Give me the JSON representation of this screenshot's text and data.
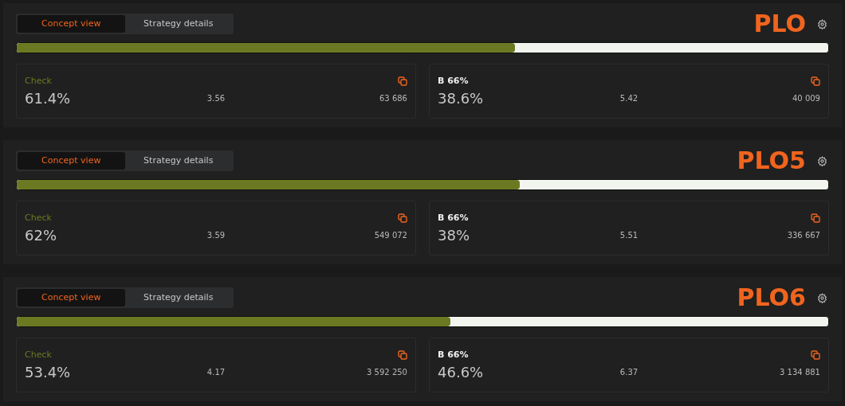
{
  "panels": [
    {
      "tabs": [
        {
          "label": "Concept view",
          "selected": true
        },
        {
          "label": "Strategy details",
          "selected": false
        }
      ],
      "title": "PLO",
      "bar": {
        "level": 0.614
      },
      "cards": [
        {
          "kind": "check",
          "label": "Check",
          "percent": "61.4%",
          "value": "3.56",
          "count": "63 686"
        },
        {
          "kind": "bet",
          "label": "B 66%",
          "percent": "38.6%",
          "value": "5.42",
          "count": "40 009"
        }
      ]
    },
    {
      "tabs": [
        {
          "label": "Concept view",
          "selected": true
        },
        {
          "label": "Strategy details",
          "selected": false
        }
      ],
      "title": "PLO5",
      "bar": {
        "level": 0.62
      },
      "cards": [
        {
          "kind": "check",
          "label": "Check",
          "percent": "62%",
          "value": "3.59",
          "count": "549 072"
        },
        {
          "kind": "bet",
          "label": "B 66%",
          "percent": "38%",
          "value": "5.51",
          "count": "336 667"
        }
      ]
    },
    {
      "tabs": [
        {
          "label": "Concept view",
          "selected": true
        },
        {
          "label": "Strategy details",
          "selected": false
        }
      ],
      "title": "PLO6",
      "bar": {
        "level": 0.534
      },
      "cards": [
        {
          "kind": "check",
          "label": "Check",
          "percent": "53.4%",
          "value": "4.17",
          "count": "3 592 250"
        },
        {
          "kind": "bet",
          "label": "B 66%",
          "percent": "46.6%",
          "value": "6.37",
          "count": "3 134 881"
        }
      ]
    }
  ]
}
